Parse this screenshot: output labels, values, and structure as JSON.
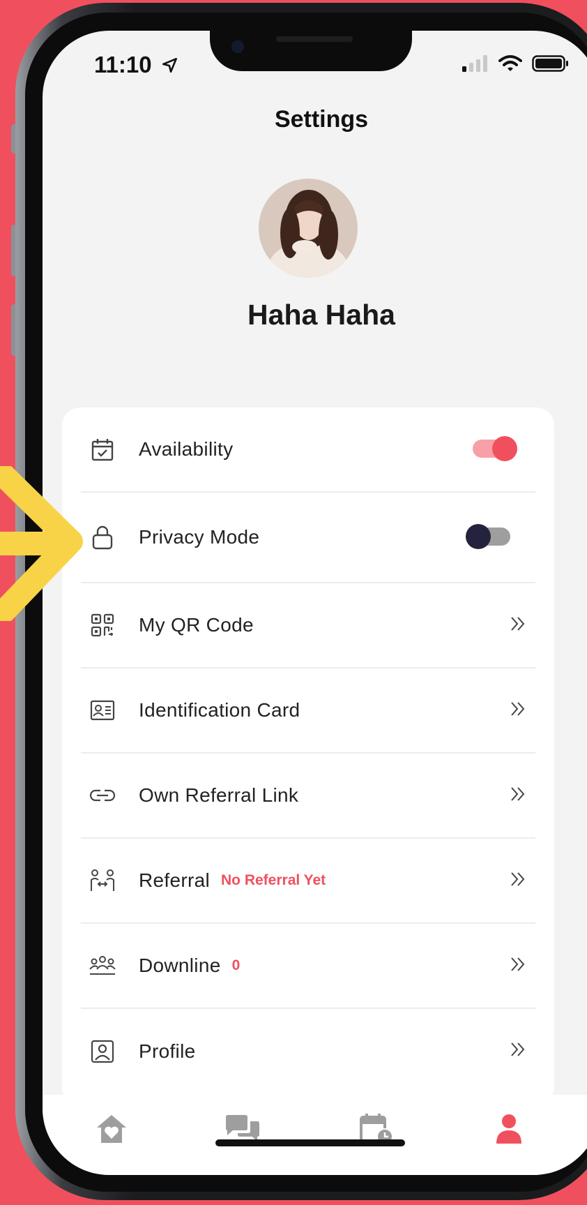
{
  "status_bar": {
    "time": "11:10"
  },
  "header": {
    "title": "Settings"
  },
  "profile": {
    "name": "Haha Haha"
  },
  "settings": {
    "availability": {
      "label": "Availability",
      "enabled": true
    },
    "privacy_mode": {
      "label": "Privacy Mode",
      "enabled": false
    },
    "qr_code": {
      "label": "My QR Code"
    },
    "identification_card": {
      "label": "Identification Card"
    },
    "own_referral_link": {
      "label": "Own Referral Link"
    },
    "referral": {
      "label": "Referral",
      "badge": "No Referral Yet"
    },
    "downline": {
      "label": "Downline",
      "count": "0"
    },
    "profile": {
      "label": "Profile"
    }
  },
  "tab_bar": {
    "tabs": [
      {
        "icon": "home-heart-icon",
        "active": false
      },
      {
        "icon": "chat-icon",
        "active": false
      },
      {
        "icon": "calendar-clock-icon",
        "active": false
      },
      {
        "icon": "person-icon",
        "active": true
      }
    ]
  },
  "colors": {
    "accent": "#f0505e",
    "toggle_on_track": "#f7a0a8",
    "toggle_off_knob": "#23233d",
    "icon_gray": "#9e9e9e",
    "background": "#f3f3f3",
    "annotation_arrow": "#f9d347"
  }
}
